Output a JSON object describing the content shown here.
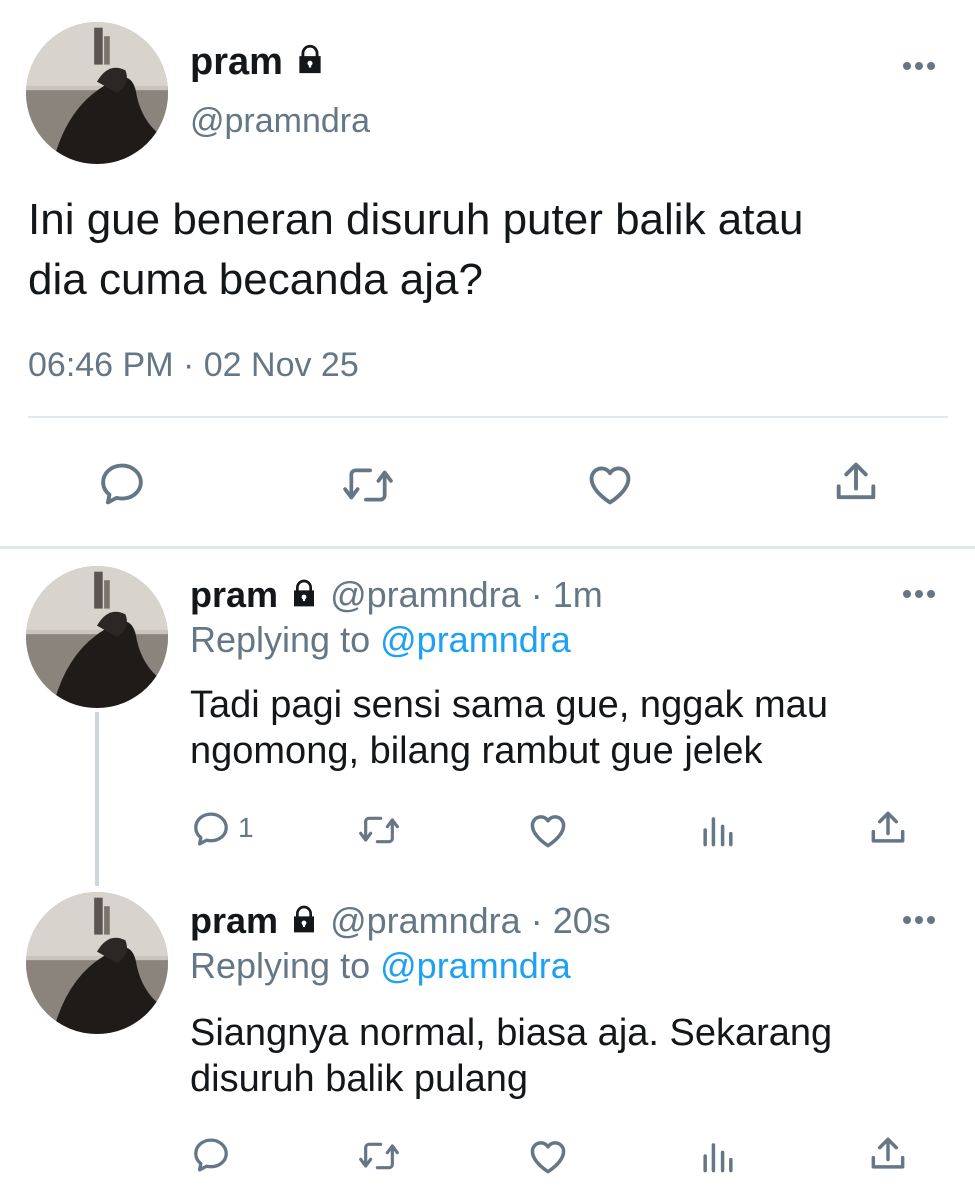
{
  "main_tweet": {
    "display_name": "pram",
    "handle": "@pramndra",
    "text_line1": "Ini gue beneran disuruh puter balik atau",
    "text_line2": "dia cuma becanda aja?",
    "timestamp": "06:46 PM · 02 Nov 25",
    "actions": {
      "reply_icon": "reply-icon",
      "retweet_icon": "retweet-icon",
      "like_icon": "heart-icon",
      "share_icon": "share-icon"
    }
  },
  "replies": [
    {
      "display_name": "pram",
      "handle": "@pramndra",
      "time": "· 1m",
      "replying_prefix": "Replying to",
      "replying_handle": "@pramndra",
      "text_line1": "Tadi pagi sensi sama gue, nggak mau",
      "text_line2": "ngomong, bilang rambut gue jelek",
      "reply_count": "1"
    },
    {
      "display_name": "pram",
      "handle": "@pramndra",
      "time": "· 20s",
      "replying_prefix": "Replying to",
      "replying_handle": "@pramndra",
      "text_line1": "Siangnya normal, biasa aja. Sekarang",
      "text_line2": "disuruh balik pulang",
      "reply_count": ""
    }
  ],
  "colors": {
    "text": "#14171a",
    "secondary": "#657786",
    "link": "#1da1f2",
    "divider": "#e1e8ed"
  }
}
